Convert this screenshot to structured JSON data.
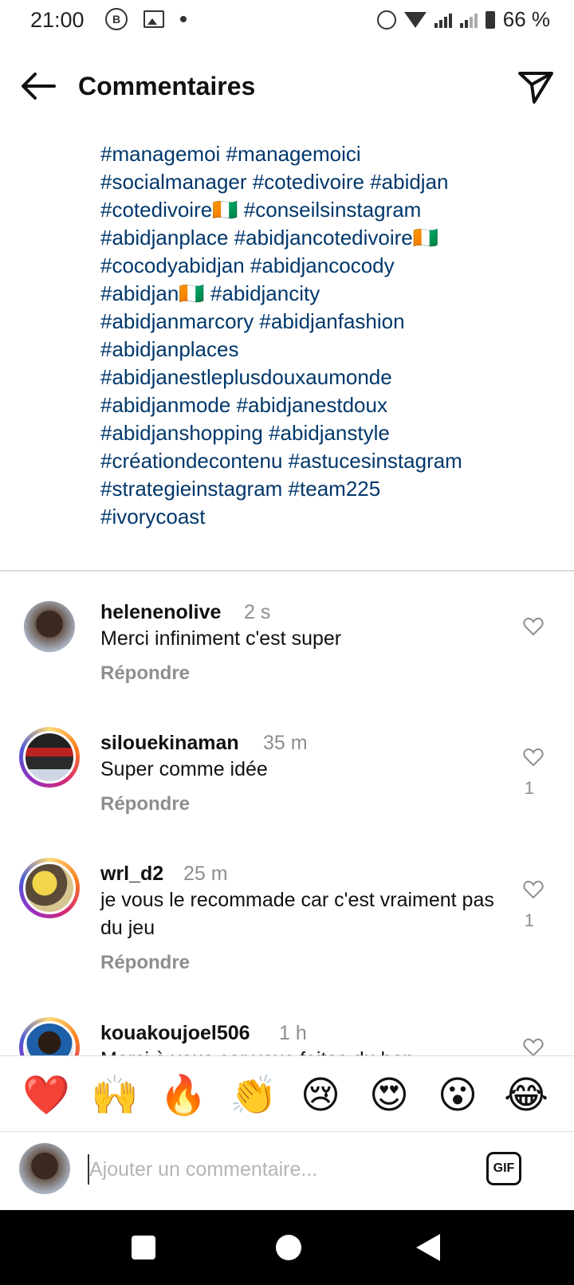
{
  "status_bar": {
    "time": "21:00",
    "battery": "66 %",
    "icons": [
      "b-circle-icon",
      "image-alert-icon",
      "dot-icon",
      "alarm-icon",
      "wifi-icon",
      "signal-icon",
      "battery-icon"
    ]
  },
  "header": {
    "title": "Commentaires",
    "back_icon": "arrow-left-icon",
    "send_icon": "paper-plane-icon"
  },
  "caption": {
    "lines": [
      "#managemoi #managemoici",
      "#socialmanager #cotedivoire #abidjan",
      "#cotedivoire🇨🇮 #conseilsinstagram",
      "#abidjanplace #abidjancotedivoire🇨🇮",
      "#cocodyabidjan #abidjancocody",
      "#abidjan🇨🇮 #abidjancity",
      "#abidjanmarcory #abidjanfashion",
      "#abidjanplaces",
      "#abidjanestleplusdouxaumonde",
      "#abidjanmode #abidjanestdoux",
      "#abidjanshopping #abidjanstyle",
      "#créationdecontenu #astucesinstagram",
      "#strategieinstagram #team225",
      "#ivorycoast"
    ]
  },
  "comments": [
    {
      "username": "helenenolive",
      "time": "2 s",
      "text": "Merci infiniment c'est super",
      "reply": "Répondre",
      "likes": ""
    },
    {
      "username": "silouekinaman",
      "time": "35 m",
      "text": "Super comme idée",
      "reply": "Répondre",
      "likes": "1"
    },
    {
      "username": "wrl_d2",
      "time": "25 m",
      "text": "je vous le recommade car c'est vraiment pas du jeu",
      "reply": "Répondre",
      "likes": "1"
    },
    {
      "username": "kouakoujoel506",
      "time": "1 h",
      "text": "Merci à vous car vous faites du bon",
      "reply": "",
      "likes": ""
    }
  ],
  "emoji_bar": [
    "❤️",
    "🙌",
    "🔥",
    "👏",
    "😢",
    "😍",
    "😮",
    "😂"
  ],
  "comment_input": {
    "placeholder": "Ajouter un commentaire...",
    "value": "",
    "gif_label": "GIF"
  },
  "colors": {
    "hashtag": "#00376b",
    "muted": "#8e8e8e",
    "divider": "#dbdbdb"
  }
}
